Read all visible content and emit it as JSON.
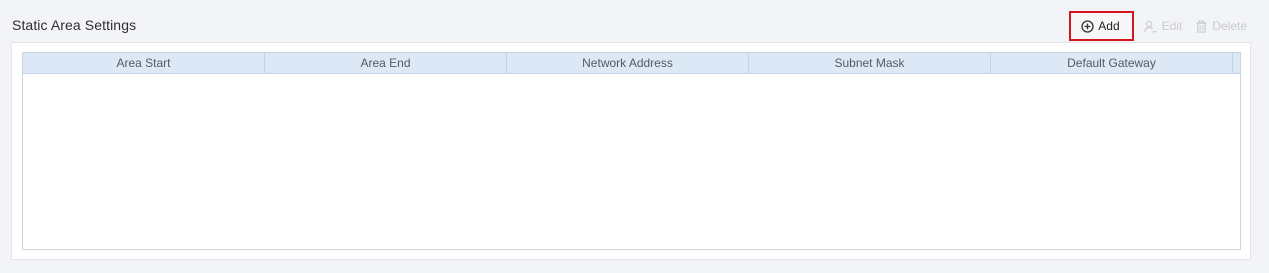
{
  "section": {
    "title": "Static Area Settings"
  },
  "toolbar": {
    "add_label": "Add",
    "edit_label": "Edit",
    "delete_label": "Delete"
  },
  "table": {
    "columns": [
      "Area Start",
      "Area End",
      "Network Address",
      "Subnet Mask",
      "Default Gateway"
    ],
    "rows": []
  },
  "colors": {
    "highlight_border": "#d3151c",
    "header_bg": "#dde8f6",
    "disabled_text": "#c9cbd0"
  }
}
